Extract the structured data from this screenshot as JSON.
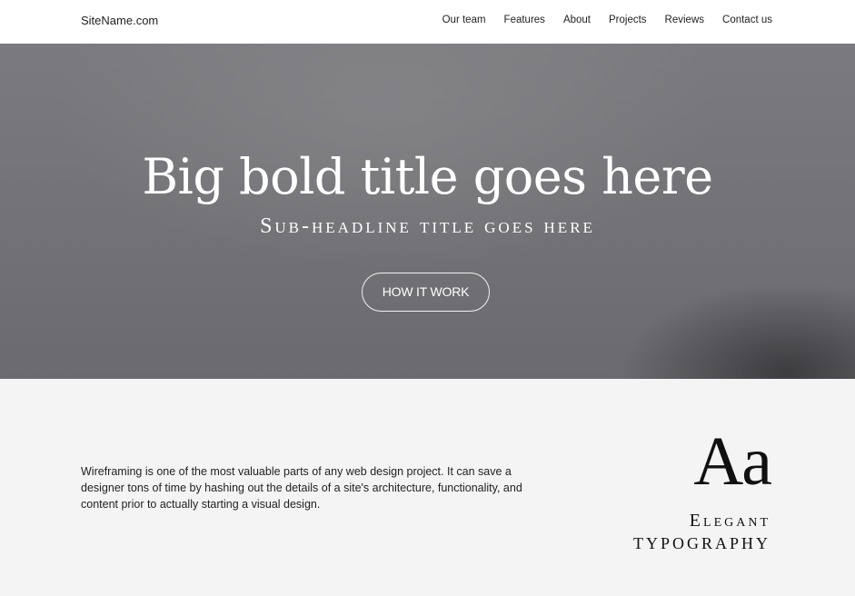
{
  "header": {
    "brand": "SiteName.com",
    "nav": [
      "Our team",
      "Features",
      "About",
      "Projects",
      "Reviews",
      "Contact us"
    ]
  },
  "hero": {
    "title": "Big bold title goes here",
    "subtitle": "Sub-headline title goes here",
    "button_label": "HOW IT WORK"
  },
  "features": {
    "paragraph": "Wireframing is one of the most valuable parts of any web design project. It can save a designer tons of time by hashing out the details of a site's architecture, functionality, and content prior to actually starting a visual design.",
    "sample_glyphs": "Aa",
    "caption_line1": "Elegant",
    "caption_line2": "TYPOGRAPHY"
  },
  "colors": {
    "hero_gray": "#747478",
    "section_bg": "#f4f4f4",
    "header_bg": "#ffffff"
  }
}
